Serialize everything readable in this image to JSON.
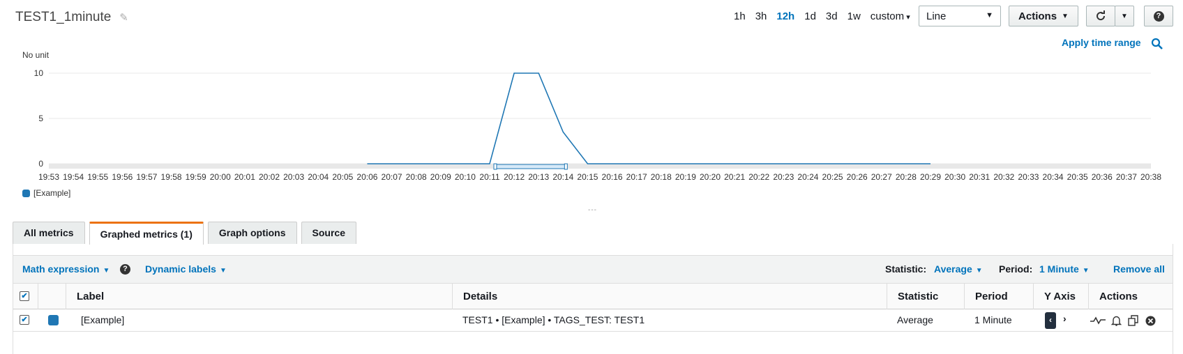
{
  "header": {
    "title": "TEST1_1minute",
    "time_ranges": [
      "1h",
      "3h",
      "12h",
      "1d",
      "3d",
      "1w",
      "custom"
    ],
    "active_range": "12h",
    "chart_type_select": "Line",
    "actions_label": "Actions",
    "apply_time_range": "Apply time range"
  },
  "chart_data": {
    "type": "line",
    "ylabel": "No unit",
    "y_ticks": [
      0,
      5,
      10
    ],
    "ylim": [
      0,
      10
    ],
    "x_ticks": [
      "19:53",
      "19:54",
      "19:55",
      "19:56",
      "19:57",
      "19:58",
      "19:59",
      "20:00",
      "20:01",
      "20:02",
      "20:03",
      "20:04",
      "20:05",
      "20:06",
      "20:07",
      "20:08",
      "20:09",
      "20:10",
      "20:11",
      "20:12",
      "20:13",
      "20:14",
      "20:15",
      "20:16",
      "20:17",
      "20:18",
      "20:19",
      "20:20",
      "20:21",
      "20:22",
      "20:23",
      "20:24",
      "20:25",
      "20:26",
      "20:27",
      "20:28",
      "20:29",
      "20:30",
      "20:31",
      "20:32",
      "20:33",
      "20:34",
      "20:35",
      "20:36",
      "20:37",
      "20:38"
    ],
    "series": [
      {
        "name": "[Example]",
        "color": "#1f77b4",
        "x": [
          "20:06",
          "20:07",
          "20:08",
          "20:09",
          "20:10",
          "20:11",
          "20:12",
          "20:13",
          "20:14",
          "20:15",
          "20:16",
          "20:17",
          "20:18",
          "20:19",
          "20:20",
          "20:21",
          "20:22",
          "20:23",
          "20:24",
          "20:25",
          "20:26",
          "20:27",
          "20:28",
          "20:29"
        ],
        "values": [
          0,
          0,
          0,
          0,
          0,
          0,
          10,
          10,
          3.5,
          0,
          0,
          0,
          0,
          0,
          0,
          0,
          0,
          0,
          0,
          0,
          0,
          0,
          0,
          0
        ]
      }
    ],
    "grid": true,
    "legend_position": "bottom-left",
    "brush_range": [
      "20:11",
      "20:14"
    ]
  },
  "legend": {
    "label": "[Example]"
  },
  "divider": "---",
  "tabs": [
    {
      "label": "All metrics"
    },
    {
      "label": "Graphed metrics (1)",
      "active": true
    },
    {
      "label": "Graph options"
    },
    {
      "label": "Source"
    }
  ],
  "toolbar": {
    "math_expression": "Math expression",
    "dynamic_labels": "Dynamic labels",
    "statistic_label": "Statistic:",
    "statistic_value": "Average",
    "period_label": "Period:",
    "period_value": "1 Minute",
    "remove_all": "Remove all"
  },
  "table": {
    "headers": {
      "label": "Label",
      "details": "Details",
      "statistic": "Statistic",
      "period": "Period",
      "y_axis": "Y Axis",
      "actions": "Actions"
    },
    "rows": [
      {
        "label": "[Example]",
        "details": "TEST1 • [Example] • TAGS_TEST: TEST1",
        "statistic": "Average",
        "period": "1 Minute",
        "checked": true,
        "color": "#1f77b4"
      }
    ]
  },
  "icons": [
    "pencil-icon",
    "refresh-icon",
    "help-icon",
    "zoom-icon",
    "info-icon",
    "chevron-left-icon",
    "chevron-right-icon",
    "graph-icon",
    "bell-icon",
    "copy-icon",
    "remove-icon"
  ]
}
